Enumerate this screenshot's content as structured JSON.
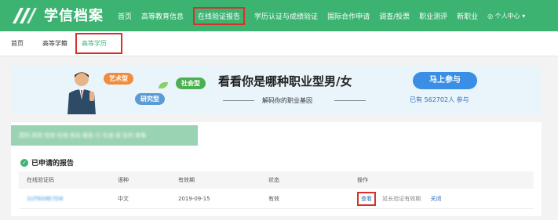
{
  "brand": {
    "name": "学信档案"
  },
  "nav": {
    "items": [
      "首页",
      "高等教育信息",
      "在线验证报告",
      "学历认证与成绩验证",
      "国际合作申请",
      "调查/投票",
      "职业测评",
      "新职业"
    ],
    "active_index": 2,
    "user": "个人中心"
  },
  "subnav": {
    "items": [
      "首页",
      "高等学籍",
      "高等学历"
    ],
    "active_index": 2
  },
  "banner": {
    "title": "看看你是哪种职业型男/女",
    "subtitle": "解码你的职业基因",
    "tags": [
      "艺术型",
      "社会型",
      "研究型"
    ],
    "cta": "马上参与",
    "participants": "已有 562702人 参与"
  },
  "notice": {
    "text": "您的·高校·校验·在线·验证·报告·已·生成·请·及时·查看"
  },
  "reports": {
    "title": "已申请的报告",
    "columns": [
      "在线验证码",
      "语种",
      "有效期",
      "状态",
      "操作"
    ],
    "rows": [
      {
        "code": "1UT6X8E7D8",
        "language": "中文",
        "expiry": "2019-09-15",
        "status": "有效",
        "view": "查看",
        "extend": "延长验证有效期",
        "close": "关闭"
      }
    ]
  },
  "colors": {
    "brand_green": "#3cb371",
    "highlight_red": "#d9302b",
    "link_blue": "#2f6fb5"
  }
}
